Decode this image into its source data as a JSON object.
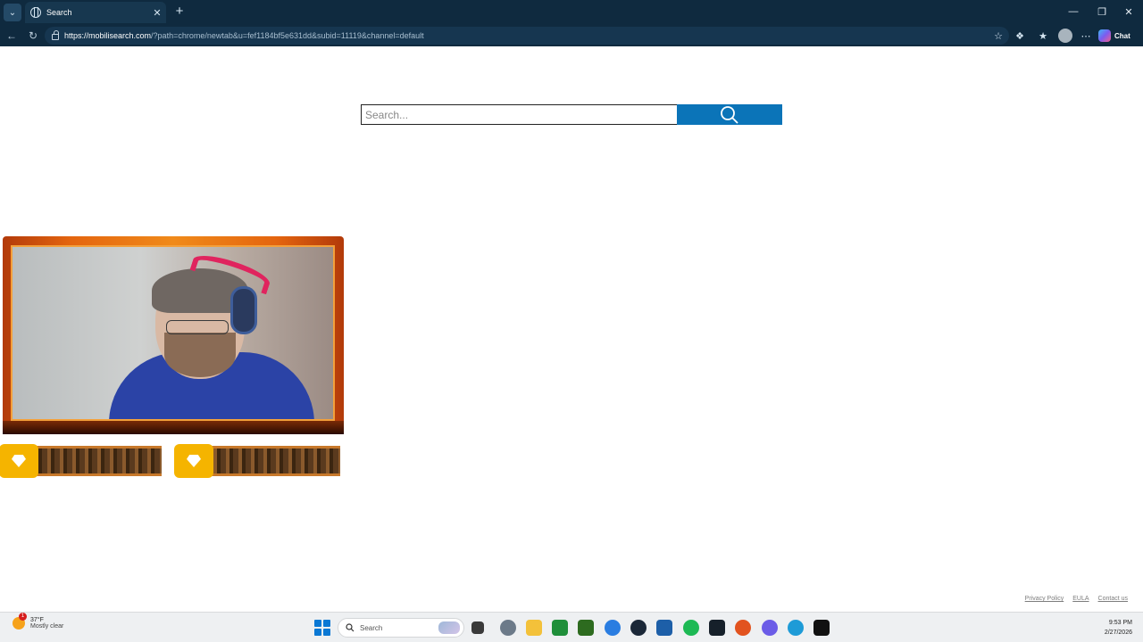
{
  "browser": {
    "tab_title": "Search",
    "url_host": "https://mobilisearch.com",
    "url_rest": "/?path=chrome/newtab&u=fef1184bf5e631dd&subid=11119&channel=default",
    "chat_label": "Chat"
  },
  "page": {
    "search_placeholder": "Search...",
    "footer": {
      "privacy": "Privacy Policy",
      "eula": "EULA",
      "contact": "Contact us"
    }
  },
  "taskbar": {
    "weather_temp": "37°F",
    "weather_condition": "Mostly clear",
    "weather_badge": "1",
    "search_label": "Search",
    "time": "9:53 PM",
    "date": "2/27/2026"
  },
  "colors": {
    "search_button": "#0b74b8",
    "browser_frame": "#0f2a3f",
    "taskbar": "#eef0f2"
  }
}
